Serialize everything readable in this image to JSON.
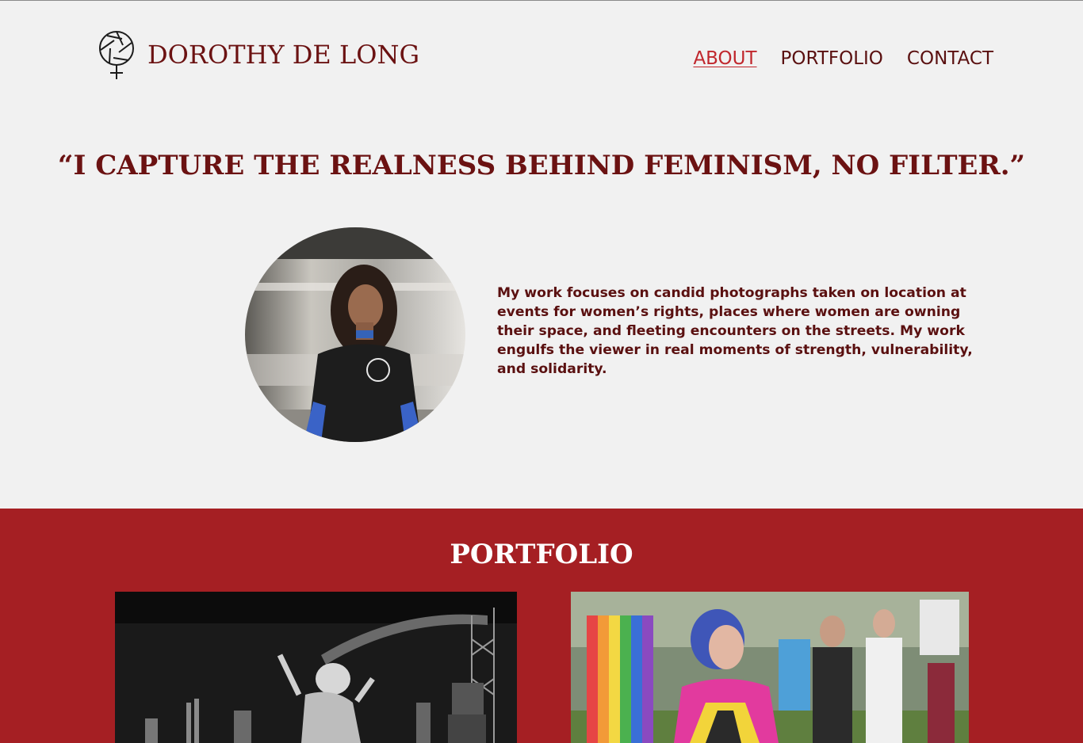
{
  "header": {
    "brand": "DOROTHY DE LONG",
    "logo_icon": "aperture-female-symbol-icon",
    "nav": [
      {
        "label": "ABOUT",
        "active": true
      },
      {
        "label": "PORTFOLIO",
        "active": false
      },
      {
        "label": "CONTACT",
        "active": false
      }
    ]
  },
  "about": {
    "quote": "“I CAPTURE THE REALNESS BEHIND FEMINISM, NO FILTER.”",
    "bio": "My work focuses on candid photographs taken on location at events for women’s rights, places where women are owning their space, and fleeting encounters on the streets. My work engulfs the viewer in real moments of strength, vulnerability, and solidarity."
  },
  "portfolio": {
    "title": "PORTFOLIO"
  },
  "colors": {
    "background": "#f1f1f1",
    "brand": "#6b1212",
    "accent": "#c0272d",
    "portfolio_bg": "#a51f23"
  }
}
